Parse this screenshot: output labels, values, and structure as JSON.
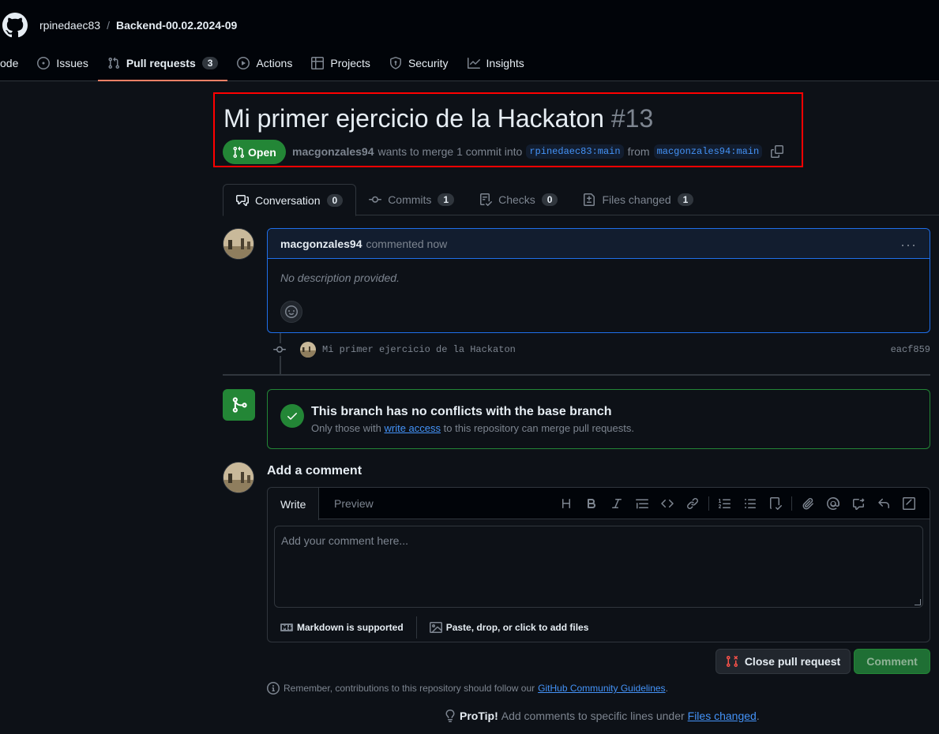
{
  "header": {
    "owner": "rpinedaec83",
    "separator": "/",
    "repo": "Backend-00.02.2024-09"
  },
  "nav": {
    "code": "ode",
    "issues": "Issues",
    "pull_requests": "Pull requests",
    "pull_requests_count": "3",
    "actions": "Actions",
    "projects": "Projects",
    "security": "Security",
    "insights": "Insights"
  },
  "pr": {
    "title": "Mi primer ejercicio de la Hackaton",
    "number": "#13",
    "state": "Open",
    "author": "macgonzales94",
    "merge_text": "wants to merge 1 commit into",
    "base_branch": "rpinedaec83:main",
    "from_text": "from",
    "head_branch": "macgonzales94:main"
  },
  "tabs": {
    "conversation": "Conversation",
    "conversation_count": "0",
    "commits": "Commits",
    "commits_count": "1",
    "checks": "Checks",
    "checks_count": "0",
    "files_changed": "Files changed",
    "files_changed_count": "1"
  },
  "comment": {
    "author": "macgonzales94",
    "meta": "commented now",
    "body": "No description provided.",
    "menu": "···"
  },
  "commit": {
    "message": "Mi primer ejercicio de la Hackaton",
    "sha": "eacf859"
  },
  "merge_status": {
    "title": "This branch has no conflicts with the base branch",
    "sub_before": "Only those with",
    "sub_link": "write access",
    "sub_after": "to this repository can merge pull requests."
  },
  "editor": {
    "heading": "Add a comment",
    "tab_write": "Write",
    "tab_preview": "Preview",
    "placeholder": "Add your comment here...",
    "markdown_note": "Markdown is supported",
    "files_note": "Paste, drop, or click to add files"
  },
  "buttons": {
    "close_pr": "Close pull request",
    "comment": "Comment"
  },
  "footer": {
    "remember_text": "Remember, contributions to this repository should follow our",
    "guidelines_link": "GitHub Community Guidelines",
    "period": ".",
    "protip_label": "ProTip!",
    "protip_text": "Add comments to specific lines under",
    "protip_link": "Files changed",
    "protip_end": "."
  },
  "colors": {
    "background": "#0d1117",
    "header": "#010409",
    "accent_green": "#238636",
    "link_blue": "#4493f8",
    "tab_underline": "#f78166",
    "highlight_border": "#ff0000"
  }
}
